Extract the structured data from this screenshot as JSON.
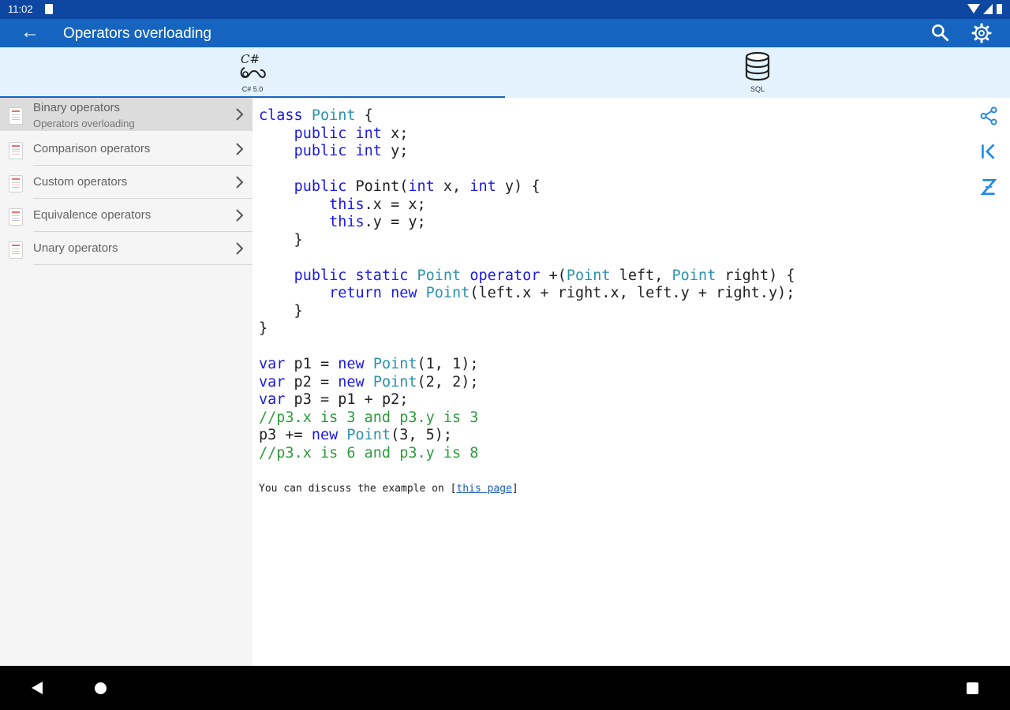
{
  "status_bar": {
    "time": "11:02"
  },
  "app_bar": {
    "title": "Operators overloading"
  },
  "tabs": [
    {
      "label": "C# 5.0",
      "icon": "csharp-icon",
      "active": true
    },
    {
      "label": "SQL",
      "icon": "database-icon",
      "active": false
    }
  ],
  "sidebar": {
    "items": [
      {
        "label": "Binary operators",
        "sublabel": "Operators overloading",
        "selected": true
      },
      {
        "label": "Comparison operators"
      },
      {
        "label": "Custom operators"
      },
      {
        "label": "Equivalence operators"
      },
      {
        "label": "Unary operators"
      }
    ]
  },
  "code": {
    "lines": [
      [
        [
          "kw",
          "class"
        ],
        [
          "",
          " "
        ],
        [
          "tp",
          "Point"
        ],
        [
          "",
          " {"
        ]
      ],
      [
        [
          "",
          "    "
        ],
        [
          "kw",
          "public"
        ],
        [
          "",
          " "
        ],
        [
          "kw",
          "int"
        ],
        [
          "",
          " x;"
        ]
      ],
      [
        [
          "",
          "    "
        ],
        [
          "kw",
          "public"
        ],
        [
          "",
          " "
        ],
        [
          "kw",
          "int"
        ],
        [
          "",
          " y;"
        ]
      ],
      [],
      [
        [
          "",
          "    "
        ],
        [
          "kw",
          "public"
        ],
        [
          "",
          " Point("
        ],
        [
          "kw",
          "int"
        ],
        [
          "",
          " x, "
        ],
        [
          "kw",
          "int"
        ],
        [
          "",
          " y) {"
        ]
      ],
      [
        [
          "",
          "        "
        ],
        [
          "kw",
          "this"
        ],
        [
          "",
          ".x = x;"
        ]
      ],
      [
        [
          "",
          "        "
        ],
        [
          "kw",
          "this"
        ],
        [
          "",
          ".y = y;"
        ]
      ],
      [
        [
          "",
          "    }"
        ]
      ],
      [],
      [
        [
          "",
          "    "
        ],
        [
          "kw",
          "public"
        ],
        [
          "",
          " "
        ],
        [
          "kw",
          "static"
        ],
        [
          "",
          " "
        ],
        [
          "tp",
          "Point"
        ],
        [
          "",
          " "
        ],
        [
          "kw",
          "operator"
        ],
        [
          "",
          " +("
        ],
        [
          "tp",
          "Point"
        ],
        [
          "",
          " left, "
        ],
        [
          "tp",
          "Point"
        ],
        [
          "",
          " right) {"
        ]
      ],
      [
        [
          "",
          "        "
        ],
        [
          "kw",
          "return"
        ],
        [
          "",
          " "
        ],
        [
          "kw",
          "new"
        ],
        [
          "",
          " "
        ],
        [
          "tp",
          "Point"
        ],
        [
          "",
          "(left.x + right.x, left.y + right.y);"
        ]
      ],
      [
        [
          "",
          "    }"
        ]
      ],
      [
        [
          "",
          "}"
        ]
      ],
      [],
      [
        [
          "kw",
          "var"
        ],
        [
          "",
          " p1 = "
        ],
        [
          "kw",
          "new"
        ],
        [
          "",
          " "
        ],
        [
          "tp",
          "Point"
        ],
        [
          "",
          "(1, 1);"
        ]
      ],
      [
        [
          "kw",
          "var"
        ],
        [
          "",
          " p2 = "
        ],
        [
          "kw",
          "new"
        ],
        [
          "",
          " "
        ],
        [
          "tp",
          "Point"
        ],
        [
          "",
          "(2, 2);"
        ]
      ],
      [
        [
          "kw",
          "var"
        ],
        [
          "",
          " p3 = p1 + p2;"
        ]
      ],
      [
        [
          "cm",
          "//p3.x is 3 and p3.y is 3"
        ]
      ],
      [
        [
          "",
          "p3 += "
        ],
        [
          "kw",
          "new"
        ],
        [
          "",
          " "
        ],
        [
          "tp",
          "Point"
        ],
        [
          "",
          "(3, 5);"
        ]
      ],
      [
        [
          "cm",
          "//p3.x is 6 and p3.y is 8"
        ]
      ]
    ]
  },
  "discuss": {
    "prefix": "You can discuss the example on ",
    "open_bracket": "[",
    "link": "this page",
    "close_bracket": "]"
  },
  "side_actions": [
    {
      "icon": "share-icon"
    },
    {
      "icon": "first-page-icon"
    },
    {
      "icon": "sort-az-icon"
    }
  ],
  "colors": {
    "status_bar": "#0d47a1",
    "app_bar": "#1565c0",
    "tab_bar": "#e3f2fd",
    "keyword": "#1a1ae6",
    "type": "#2b91af",
    "comment": "#2e9b3c"
  }
}
